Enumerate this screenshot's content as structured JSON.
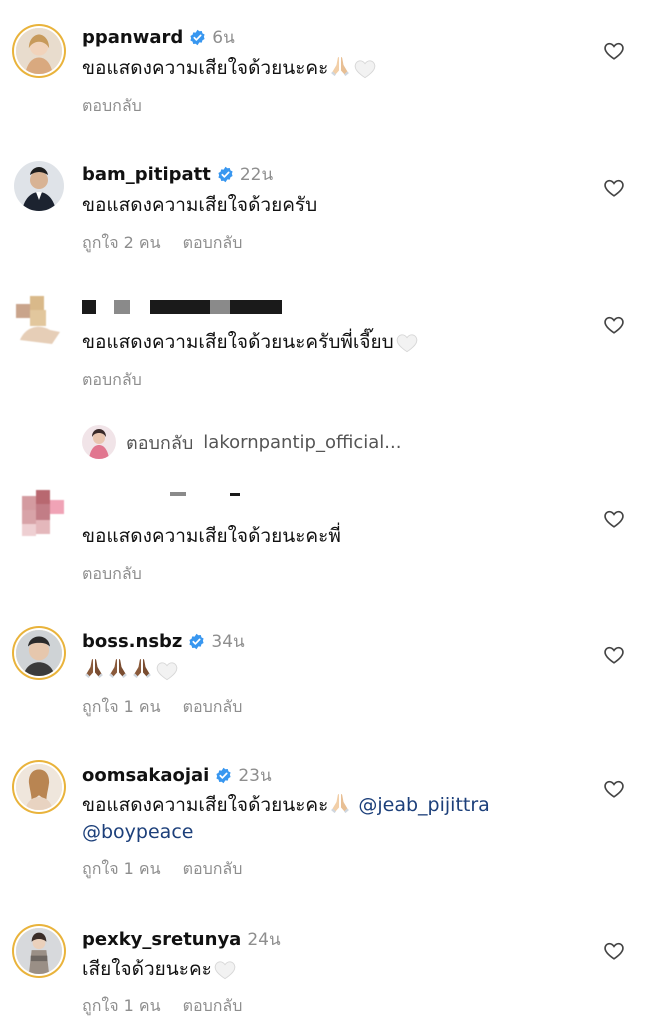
{
  "comments": [
    {
      "username": "ppanward",
      "verified": true,
      "time": "6น",
      "text": "ขอแสดงความเสียใจด้วยนะคะ",
      "likes": "",
      "reply": "ตอบกลับ"
    },
    {
      "username": "bam_pitipatt",
      "verified": true,
      "time": "22น",
      "text": "ขอแสดงความเสียใจด้วยครับ",
      "likes": "ถูกใจ 2 คน",
      "reply": "ตอบกลับ"
    },
    {
      "username": "",
      "verified": false,
      "time": "",
      "text": "ขอแสดงความเสียใจด้วยนะครับพี่เจี๊ยบ",
      "likes": "",
      "reply": "ตอบกลับ"
    },
    {
      "username": "",
      "verified": false,
      "time": "",
      "text": "ขอแสดงความเสียใจด้วยนะคะพี่",
      "likes": "",
      "reply": "ตอบกลับ"
    },
    {
      "username": "boss.nsbz",
      "verified": true,
      "time": "34น",
      "text": "",
      "likes": "ถูกใจ 1 คน",
      "reply": "ตอบกลับ"
    },
    {
      "username": "oomsakaojai",
      "verified": true,
      "time": "23น",
      "text": "ขอแสดงความเสียใจด้วยนะคะ",
      "mention1": "@jeab_pijittra",
      "mention2": "@boypeace",
      "likes": "ถูกใจ 1 คน",
      "reply": "ตอบกลับ"
    },
    {
      "username": "pexky_sretunya",
      "verified": false,
      "time": "24น",
      "text": "เสียใจด้วยนะคะ",
      "likes": "ถูกใจ 1 คน",
      "reply": "ตอบกลับ"
    }
  ],
  "reply_thread": {
    "label": "ตอบกลับ",
    "username": "lakornpantip_official..."
  },
  "icons": {
    "like": "heart-outline-icon",
    "verified": "verified-badge-icon"
  },
  "colors": {
    "verified": "#3897f0",
    "muted": "#8e8e8e",
    "mention": "#1c3f7a",
    "ring": "#e9b33b"
  }
}
